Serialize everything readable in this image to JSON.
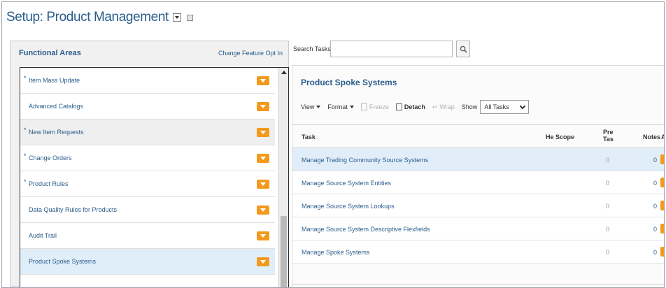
{
  "header": {
    "title": "Setup: Product Management"
  },
  "functional_areas": {
    "title": "Functional Areas",
    "change_link": "Change Feature Opt In",
    "items": [
      {
        "label": "Item Mass Update",
        "required": "*"
      },
      {
        "label": "Advanced Catalogs",
        "required": ""
      },
      {
        "label": "New Item Requests",
        "required": "*"
      },
      {
        "label": "Change Orders",
        "required": "*"
      },
      {
        "label": "Product Rules",
        "required": "*"
      },
      {
        "label": "Data Quality Rules for Products",
        "required": ""
      },
      {
        "label": "Audit Trail",
        "required": ""
      },
      {
        "label": "Product Spoke Systems",
        "required": ""
      }
    ],
    "selected_index": 7
  },
  "search": {
    "label": "Search Tasks",
    "value": ""
  },
  "tasks_panel": {
    "title": "Product Spoke Systems",
    "toolbar": {
      "view": "View",
      "format": "Format",
      "freeze": "Freeze",
      "detach": "Detach",
      "wrap": "Wrap",
      "show_label": "Show",
      "show_value": "All Tasks"
    },
    "columns": {
      "task": "Task",
      "he_scope": "He Scope",
      "pre_line1": "Pre",
      "pre_line2": "Tas",
      "notes": "Notes",
      "actions": "A"
    },
    "rows": [
      {
        "task": "Manage Trading Community Source Systems",
        "pre": "0",
        "notes": "0"
      },
      {
        "task": "Manage Source System Entities",
        "pre": "0",
        "notes": "0"
      },
      {
        "task": "Manage Source System Lookups",
        "pre": "0",
        "notes": "0"
      },
      {
        "task": "Manage Source System Descriptive Flexfields",
        "pre": "0",
        "notes": "0"
      },
      {
        "task": "Manage Spoke Systems",
        "pre": "0",
        "notes": "0"
      }
    ],
    "selected_row": 0
  },
  "colors": {
    "link": "#2a5d8c",
    "accent": "#f39a1d",
    "selection": "#e1eefa"
  }
}
